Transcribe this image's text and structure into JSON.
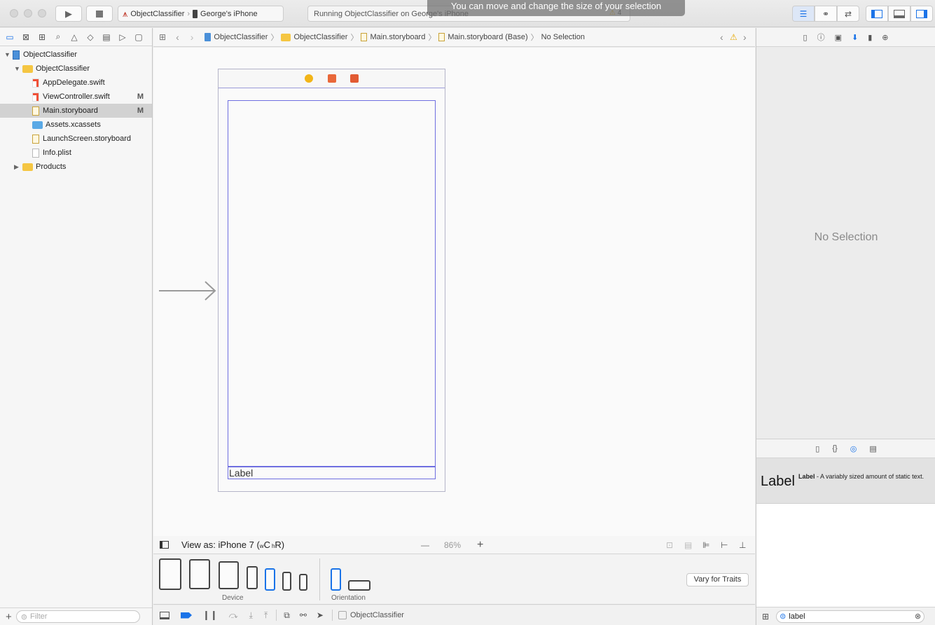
{
  "toolbar": {
    "scheme_name": "ObjectClassifier",
    "device_name": "George's iPhone",
    "activity_text": "Running ObjectClassifier on George's iPhone",
    "warning_count": "4",
    "hud_text": "You can move and change the size of your selection"
  },
  "navigator": {
    "filter_placeholder": "Filter",
    "tree": [
      {
        "label": "ObjectClassifier",
        "kind": "project",
        "flag": ""
      },
      {
        "label": "ObjectClassifier",
        "kind": "folder",
        "flag": ""
      },
      {
        "label": "AppDelegate.swift",
        "kind": "swift",
        "flag": ""
      },
      {
        "label": "ViewController.swift",
        "kind": "swift",
        "flag": "M"
      },
      {
        "label": "Main.storyboard",
        "kind": "storyboard",
        "flag": "M"
      },
      {
        "label": "Assets.xcassets",
        "kind": "assets",
        "flag": ""
      },
      {
        "label": "LaunchScreen.storyboard",
        "kind": "storyboard",
        "flag": ""
      },
      {
        "label": "Info.plist",
        "kind": "plist",
        "flag": ""
      },
      {
        "label": "Products",
        "kind": "folder",
        "flag": ""
      }
    ]
  },
  "jumpbar": {
    "crumbs": [
      "ObjectClassifier",
      "ObjectClassifier",
      "Main.storyboard",
      "Main.storyboard (Base)",
      "No Selection"
    ]
  },
  "canvas": {
    "label_text": "Label"
  },
  "editor_bottom": {
    "view_as": "View as: iPhone 7 (",
    "wc": "w",
    "c": "C ",
    "hr": "h",
    "r": "R)",
    "zoom": "86%",
    "minus": "—",
    "plus": "+"
  },
  "device_bar": {
    "device_label": "Device",
    "orientation_label": "Orientation",
    "vary_button": "Vary for Traits"
  },
  "debug_bar": {
    "target": "ObjectClassifier"
  },
  "inspector": {
    "no_selection": "No Selection",
    "lib_item_big": "Label",
    "lib_item_title": "Label",
    "lib_item_desc": " - A variably sized amount of static text.",
    "search_value": "label"
  },
  "colors": {
    "accent": "#1a73e8",
    "selection_outline": "#6e6ee0",
    "folder": "#f5c642"
  }
}
